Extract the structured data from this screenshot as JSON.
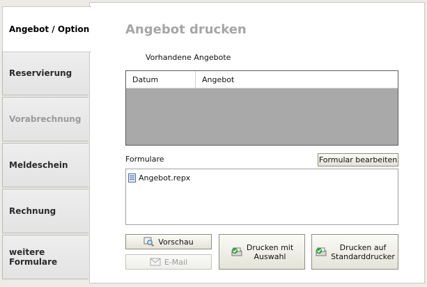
{
  "tabs": [
    {
      "label": "Angebot / Option",
      "state": "active"
    },
    {
      "label": "Reservierung",
      "state": "normal"
    },
    {
      "label": "Vorabrechnung",
      "state": "disabled"
    },
    {
      "label": "Meldeschein",
      "state": "normal"
    },
    {
      "label": "Rechnung",
      "state": "normal"
    },
    {
      "label": "weitere Formulare",
      "state": "normal"
    }
  ],
  "main": {
    "title": "Angebot drucken",
    "offers_label": "Vorhandene Angebote",
    "offers_columns": [
      "Datum",
      "Angebot"
    ],
    "forms_label": "Formulare",
    "edit_form_button": "Formular bearbeiten",
    "forms": [
      "Angebot.repx"
    ],
    "preview_button": "Vorschau",
    "email_button": "E-Mail",
    "print_selection_button": [
      "Drucken mit",
      "Auswahl"
    ],
    "print_default_button": [
      "Drucken auf",
      "Standarddrucker"
    ]
  },
  "colors": {
    "title": "#a6a6a6",
    "grid_background": "#a9a9a9",
    "disabled_text": "#9a9a9a"
  }
}
